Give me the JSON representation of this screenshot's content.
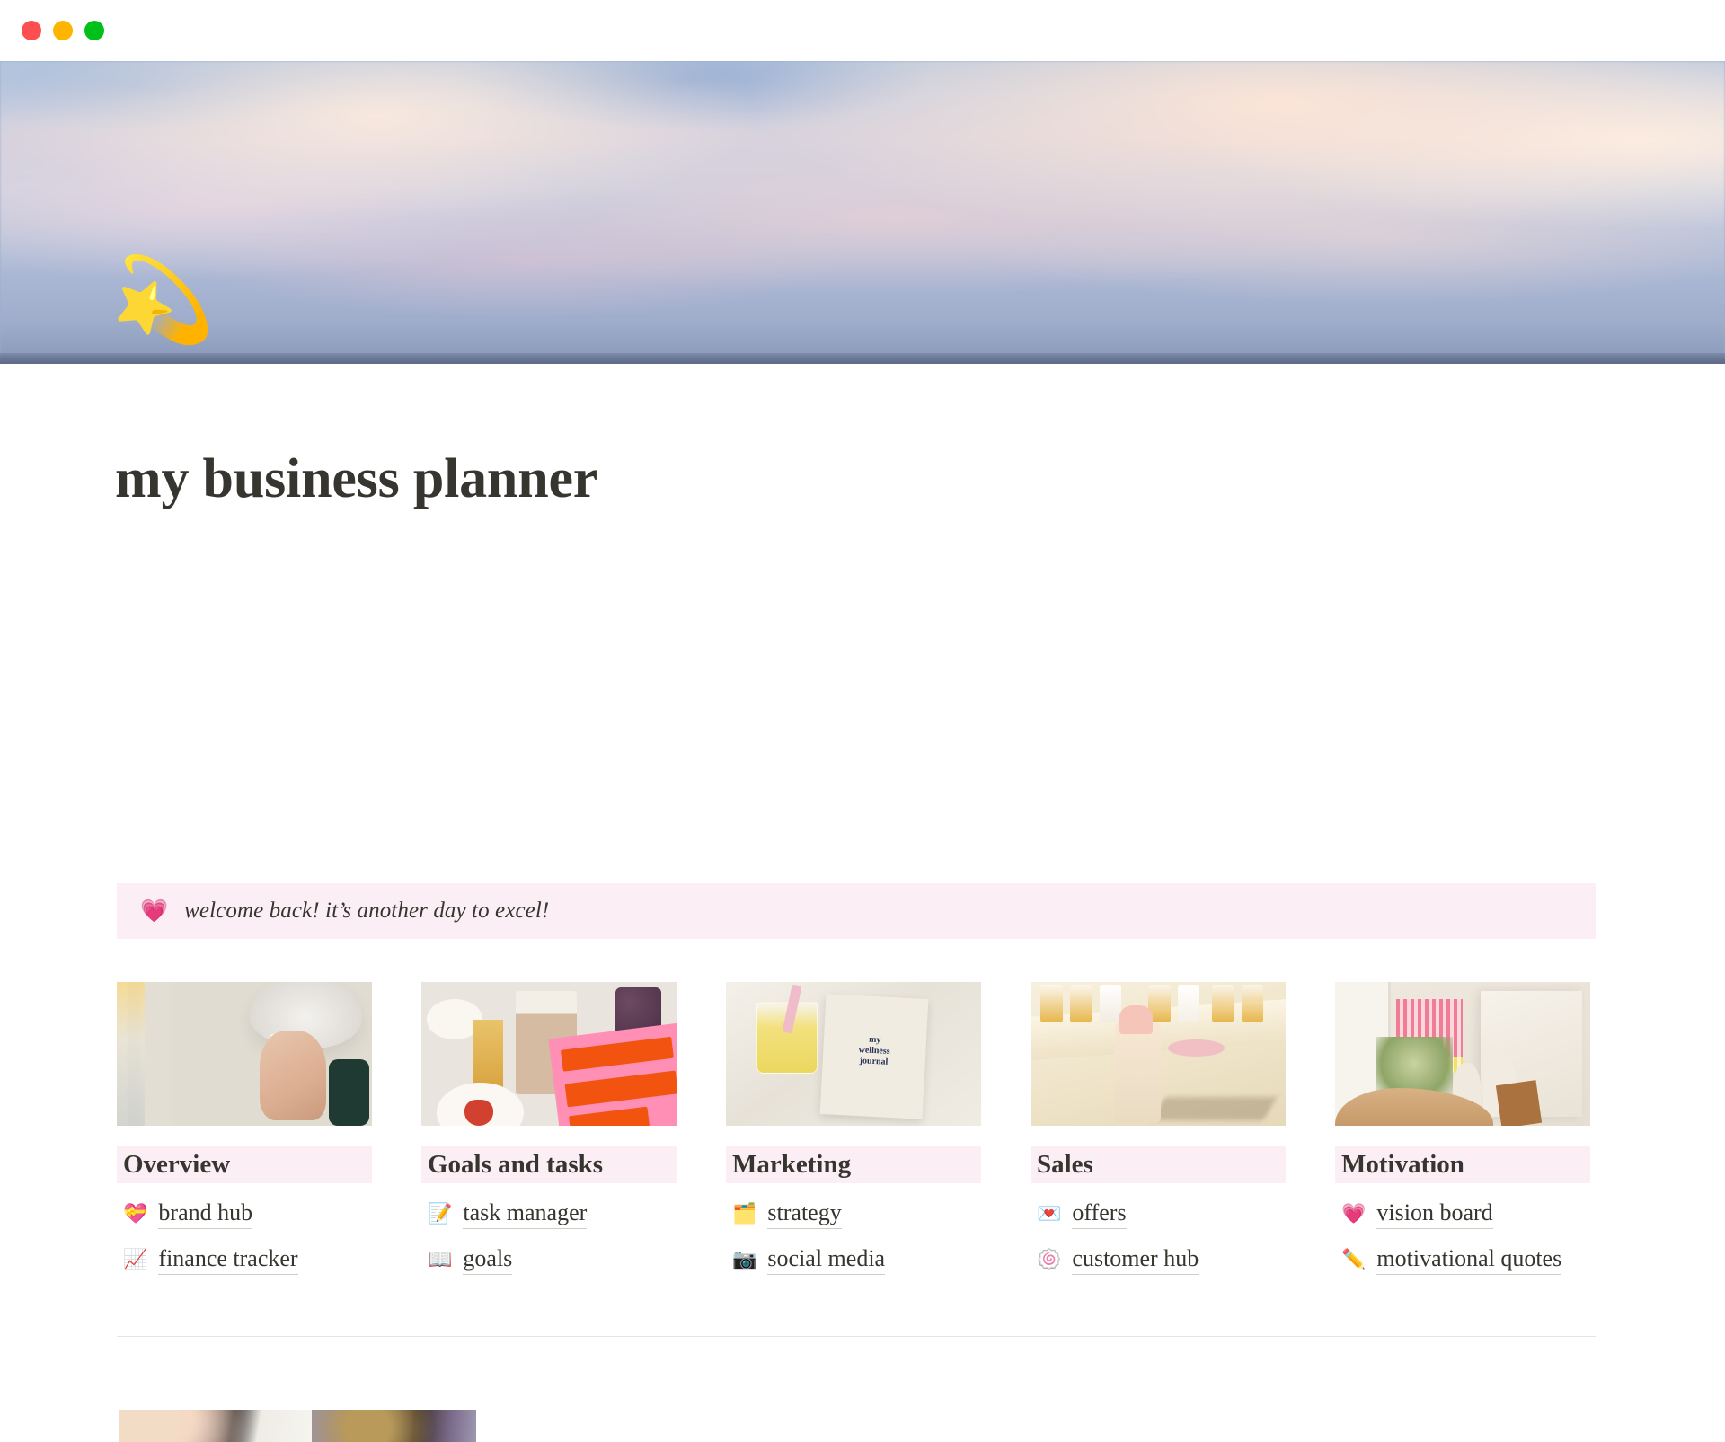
{
  "window": {
    "traffic_lights": [
      {
        "name": "close",
        "color": "#fd4f4f"
      },
      {
        "name": "minimize",
        "color": "#ffb400"
      },
      {
        "name": "maximize",
        "color": "#00c019"
      }
    ]
  },
  "cover": {
    "alt": "pastel sunset sky with clouds over water",
    "colors": {
      "sky_top": "#b9c8de",
      "sky_mid": "#d8d2dd",
      "sky_bottom": "#6e7d9b"
    }
  },
  "page": {
    "icon": "💫",
    "icon_name": "dizzy-star-emoji",
    "title": "my business planner"
  },
  "callout": {
    "emoji": "💗",
    "emoji_name": "growing-heart-emoji",
    "text": "welcome back! it’s another day to excel!",
    "background": "#fbeff5"
  },
  "columns": [
    {
      "heading": "Overview",
      "image_alt": "person in towel holding glass of lemon water mirror selfie",
      "links": [
        {
          "emoji": "💝",
          "emoji_name": "heart-with-ribbon-emoji",
          "label": "brand hub"
        },
        {
          "emoji": "📈",
          "emoji_name": "chart-increasing-emoji",
          "label": "finance tracker"
        }
      ]
    },
    {
      "heading": "Goals and tasks",
      "image_alt": "desk flatlay with iced latte, perfume and pink do it for yourself book",
      "links": [
        {
          "emoji": "📝",
          "emoji_name": "memo-emoji",
          "label": "task manager"
        },
        {
          "emoji": "📖",
          "emoji_name": "open-book-emoji",
          "label": "goals"
        }
      ]
    },
    {
      "heading": "Marketing",
      "image_alt": "my wellness journal notebook beside lemonade jar on linen",
      "links": [
        {
          "emoji": "🗂️",
          "emoji_name": "card-index-dividers-emoji",
          "label": "strategy"
        },
        {
          "emoji": "📷",
          "emoji_name": "camera-emoji",
          "label": "social media"
        }
      ]
    },
    {
      "heading": "Sales",
      "image_alt": "pink skincare serum bottle on marble counter with perfumes",
      "links": [
        {
          "emoji": "💌",
          "emoji_name": "love-letter-emoji",
          "label": "offers"
        },
        {
          "emoji": "🍥",
          "emoji_name": "fish-cake-swirl-emoji",
          "label": "customer hub"
        }
      ]
    },
    {
      "heading": "Motivation",
      "image_alt": "bright room with daisies in vase, plaster busts and textured canvas",
      "links": [
        {
          "emoji": "💗",
          "emoji_name": "growing-heart-emoji",
          "label": "vision board"
        },
        {
          "emoji": "✏️",
          "emoji_name": "pencil-emoji",
          "label": "motivational quotes"
        }
      ]
    }
  ],
  "bottom": {
    "divider": true,
    "gallery_alt_1": "partially visible photo strip",
    "gallery_alt_2": "partially visible photo strip"
  }
}
